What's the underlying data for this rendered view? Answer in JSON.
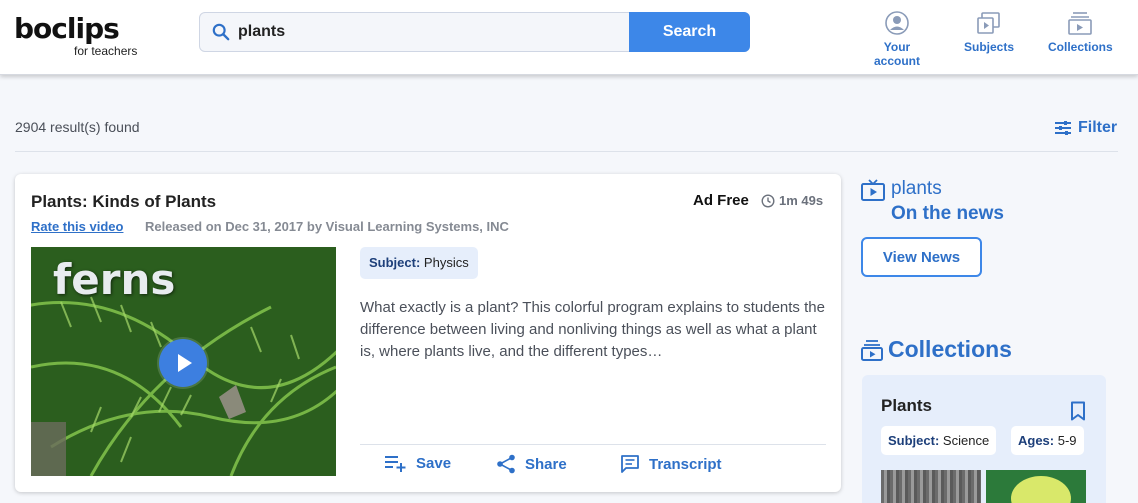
{
  "header": {
    "logo": {
      "text": "boclips",
      "tagline": "for teachers"
    },
    "search": {
      "value": "plants",
      "placeholder": "",
      "button_label": "Search"
    },
    "nav": [
      {
        "label": "Your account",
        "icon": "account-icon"
      },
      {
        "label": "Subjects",
        "icon": "subjects-icon"
      },
      {
        "label": "Collections",
        "icon": "collections-icon"
      }
    ]
  },
  "results": {
    "count_text": "2904 result(s) found",
    "filter_label": "Filter"
  },
  "video": {
    "title": "Plants: Kinds of Plants",
    "ad_free": "Ad Free",
    "duration": "1m 49s",
    "rate_label": "Rate this video",
    "released": "Released on Dec 31, 2017 by Visual Learning Systems, INC",
    "thumbnail_text": "ferns",
    "subject_key": "Subject:",
    "subject_value": "Physics",
    "description": "What exactly is a plant? This colorful program explains to students the difference between living and nonliving things as well as what a plant is, where plants live, and the different types…",
    "actions": [
      {
        "label": "Save",
        "icon": "playlist-add-icon"
      },
      {
        "label": "Share",
        "icon": "share-icon"
      },
      {
        "label": "Transcript",
        "icon": "transcript-icon"
      }
    ]
  },
  "news": {
    "query": "plants",
    "subtitle": "On the news",
    "button_label": "View News"
  },
  "collections": {
    "heading": "Collections",
    "items": [
      {
        "name": "Plants",
        "subject_key": "Subject:",
        "subject_value": "Science",
        "ages_key": "Ages:",
        "ages_value": "5-9"
      }
    ]
  },
  "colors": {
    "accent": "#3d87e8",
    "link": "#2e70c8",
    "badge_bg": "#e6eefb",
    "page_bg": "#f5f7fb"
  }
}
